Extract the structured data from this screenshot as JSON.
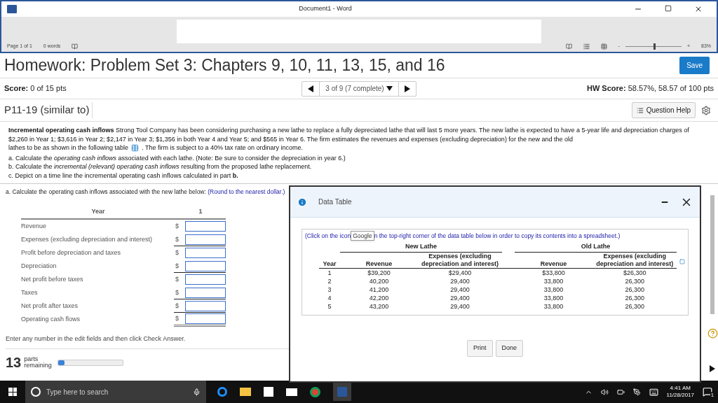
{
  "word_window": {
    "title": "Document1 - Word",
    "status": {
      "page": "Page 1 of 1",
      "words": "0 words",
      "zoom_minus": "-",
      "zoom_plus": "+",
      "zoom": "83%",
      "zoom_level": {
        "level": 0.5
      }
    }
  },
  "header": {
    "title": "Homework: Problem Set 3: Chapters 9, 10, 11, 13, 15, and 16",
    "save": "Save"
  },
  "score": {
    "label": "Score:",
    "value": "0 of 15 pts",
    "nav": "3 of 9 (7 complete)",
    "hw_label": "HW Score:",
    "hw_value": "58.57%, 58.57 of 100 pts"
  },
  "question": {
    "id": "P11-19 (similar to)",
    "help": "Question Help"
  },
  "problem": {
    "text_top": "**Incremental operating cash inflows**  Strong Tool Company has been considering purchasing a new lathe to replace a fully depreciated lathe that will last 5 more years.  The new lathe is expected to have a 5-year life and depreciation charges of $2,260 in Year 1; $3,616 in Year 2; $2,147 in Year 3; $1,356 in both Year 4 and Year 5; and $565 in Year 6.  The firm estimates the revenues and expenses (excluding depreciation) for the new and the old",
    "text_before_icon": "lathes to be as shown in the following table",
    "text_after_icon": ".  The firm is subject to a 40% tax rate on ordinary income.",
    "parts": [
      "a. Calculate the *operating cash inflows* associated with each lathe. (Note: Be sure to consider the depreciation in year 6.)",
      "b. Calculate the *incremental (relevant) operating cash inflows* resulting from the proposed lathe replacement.",
      "c. Depict on a time line the incremental operating cash inflows calculated in part **b.**"
    ]
  },
  "task": {
    "text": "a. Calculate the operating cash inflows associated with the new lathe below:",
    "hint": "(Round to the nearest dollar.)"
  },
  "form": {
    "year_label": "Year",
    "year": "1",
    "rows": [
      {
        "label": "Revenue",
        "currency": "$",
        "kind": "plain"
      },
      {
        "label": "Expenses (excluding depreciation and interest)",
        "currency": "$",
        "kind": "subtotal"
      },
      {
        "label": "Profit before depreciation and taxes",
        "currency": "$",
        "kind": "plain"
      },
      {
        "label": "Depreciation",
        "currency": "$",
        "kind": "subtotal"
      },
      {
        "label": "Net profit before taxes",
        "currency": "$",
        "kind": "plain"
      },
      {
        "label": "Taxes",
        "currency": "$",
        "kind": "subtotal"
      },
      {
        "label": "Net profit after taxes",
        "currency": "$",
        "kind": "subtotal"
      },
      {
        "label": "Operating cash flows",
        "currency": "$",
        "kind": "total"
      }
    ]
  },
  "instruction": "Enter any number in the edit fields and then click Check Answer.",
  "footer": {
    "count": "13",
    "parts": "parts",
    "remaining": "remaining",
    "progress": {
      "level": 0.1
    }
  },
  "dialog": {
    "title": "Data Table",
    "note_start": "(Click on the icon",
    "tooltip": "Google",
    "note_end": "n the top-right corner of the data table below in order to copy its contents into a spreadsheet.)",
    "groups": [
      "New Lathe",
      "Old Lathe"
    ],
    "columns": [
      "Year",
      "Revenue",
      "Expenses (excluding depreciation and interest)",
      "Revenue",
      "Expenses (excluding depreciation and interest)"
    ],
    "rows": [
      [
        "1",
        "$39,200",
        "$29,400",
        "$33,800",
        "$26,300"
      ],
      [
        "2",
        "40,200",
        "29,400",
        "33,800",
        "26,300"
      ],
      [
        "3",
        "41,200",
        "29,400",
        "33,800",
        "26,300"
      ],
      [
        "4",
        "42,200",
        "29,400",
        "33,800",
        "26,300"
      ],
      [
        "5",
        "43,200",
        "29,400",
        "33,800",
        "26,300"
      ]
    ],
    "buttons": [
      "Print",
      "Done"
    ]
  },
  "taskbar": {
    "search_placeholder": "Type here to search",
    "time": "4:41 AM",
    "date": "11/28/2017",
    "notifications": "1"
  }
}
